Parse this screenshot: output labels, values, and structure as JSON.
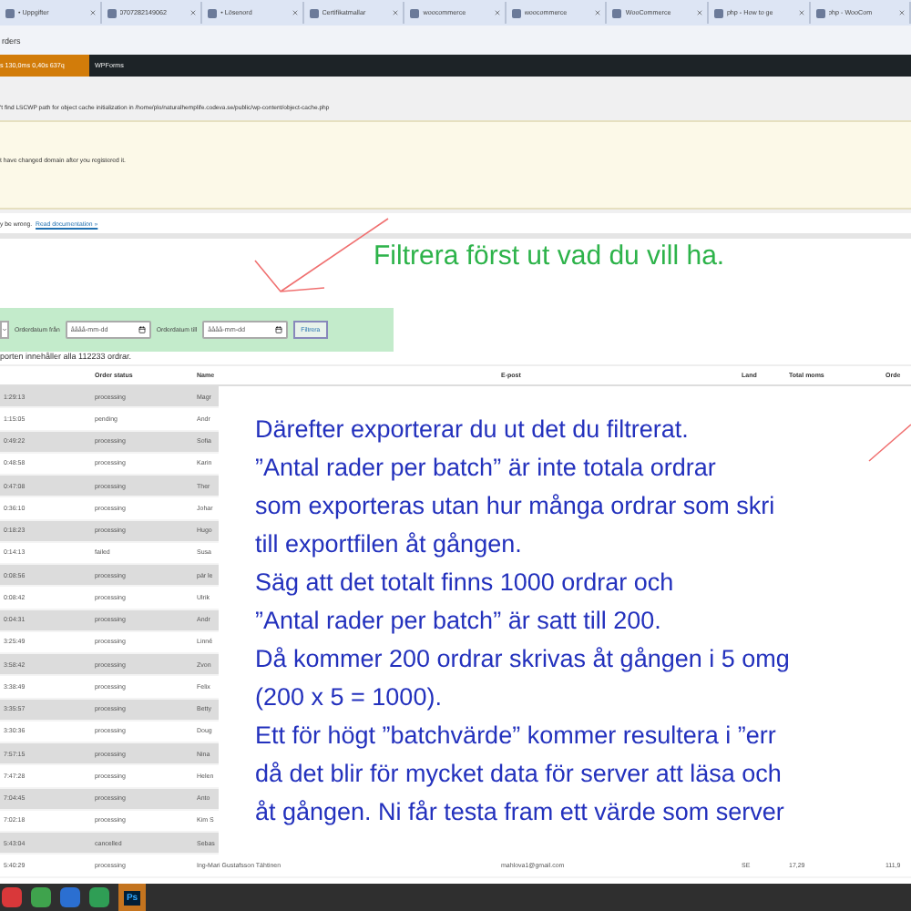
{
  "browser_tabs": [
    {
      "label": "• Uppgifter",
      "selected": false
    },
    {
      "label": "0707282149062",
      "selected": false
    },
    {
      "label": "• Lösenord",
      "selected": false
    },
    {
      "label": "Certifikatmallar",
      "selected": false
    },
    {
      "label": "woocommerce",
      "selected": false
    },
    {
      "label": "woocommerce",
      "selected": false
    },
    {
      "label": "WooCommerce",
      "selected": false
    },
    {
      "label": "php - How to ge",
      "selected": false
    },
    {
      "label": "php - WooCom",
      "selected": false
    }
  ],
  "address_bar": {
    "text": "rders"
  },
  "admin_bar": {
    "stats": "s 130,0ms 0,40s 637q",
    "items": [
      "WPForms"
    ]
  },
  "notices": [
    {
      "kind": "plain",
      "text": "'t find LSCWP path for object cache initialization in /home/plo/naturalhemplife.codeva.se/public/wp-content/object-cache.php"
    },
    {
      "kind": "warning",
      "text": "t have changed domain after you registered it."
    },
    {
      "kind": "info",
      "text": "y be wrong.",
      "link": "Read documentation »"
    }
  ],
  "annotation_top": "Filtrera först ut vad du vill ha.",
  "filter": {
    "from_label": "Orderdatum från",
    "from_placeholder": "åååå-mm-dd",
    "to_label": "Orderdatum till",
    "to_placeholder": "åååå-mm-dd",
    "button": "Filtrera"
  },
  "count_text": "porten innehåller alla 112233 ordrar.",
  "table": {
    "columns": [
      "",
      "Order status",
      "Name",
      "E-post",
      "Land",
      "Total moms",
      "Orde"
    ],
    "rows": [
      [
        "1:29:13",
        "processing",
        "Magr"
      ],
      [
        "1:15:05",
        "pending",
        "Andr"
      ],
      [
        "0:49:22",
        "processing",
        "Sofia"
      ],
      [
        "0:48:58",
        "processing",
        "Karin"
      ],
      [
        "0:47:08",
        "processing",
        "Ther"
      ],
      [
        "0:36:10",
        "processing",
        "Johar"
      ],
      [
        "0:18:23",
        "processing",
        "Hugo"
      ],
      [
        "0:14:13",
        "failed",
        "Susa"
      ],
      [
        "0:08:56",
        "processing",
        "pär le"
      ],
      [
        "0:08:42",
        "processing",
        "Ulrik"
      ],
      [
        "0:04:31",
        "processing",
        "Andr"
      ],
      [
        "3:25:49",
        "processing",
        "Linné"
      ],
      [
        "3:58:42",
        "processing",
        "Zvon"
      ],
      [
        "3:38:49",
        "processing",
        "Felix"
      ],
      [
        "3:35:57",
        "processing",
        "Betty"
      ],
      [
        "3:30:36",
        "processing",
        "Doug"
      ],
      [
        "7:57:15",
        "processing",
        "Nina"
      ],
      [
        "7:47:28",
        "processing",
        "Helen"
      ],
      [
        "7:04:45",
        "processing",
        "Anto"
      ],
      [
        "7:02:18",
        "processing",
        "Kim S"
      ],
      [
        "5:43:04",
        "cancelled",
        "Sebas"
      ]
    ],
    "last_row": [
      "5:40:29",
      "processing",
      "Ing-Mari Gustafsson Tähtinen",
      "mahlova1@gmail.com",
      "SE",
      "17,29",
      "111,9"
    ]
  },
  "annotation_lines": [
    "Därefter exporterar du ut det du filtrerat.",
    "”Antal rader per batch” är inte totala ordrar",
    "som exporteras utan hur många ordrar som skri",
    "till exportfilen åt gången.",
    "Säg att det totalt finns 1000 ordrar och",
    "”Antal rader per batch” är satt till 200.",
    "Då kommer 200 ordrar skrivas åt gången i 5 omg",
    "(200 x 5 = 1000).",
    "Ett för högt ”batchvärde” kommer resultera i ”err",
    "då det blir för mycket data för server att läsa och",
    "åt gången. Ni får testa fram ett värde som server"
  ],
  "taskbar": {
    "app_label": "Ps"
  }
}
